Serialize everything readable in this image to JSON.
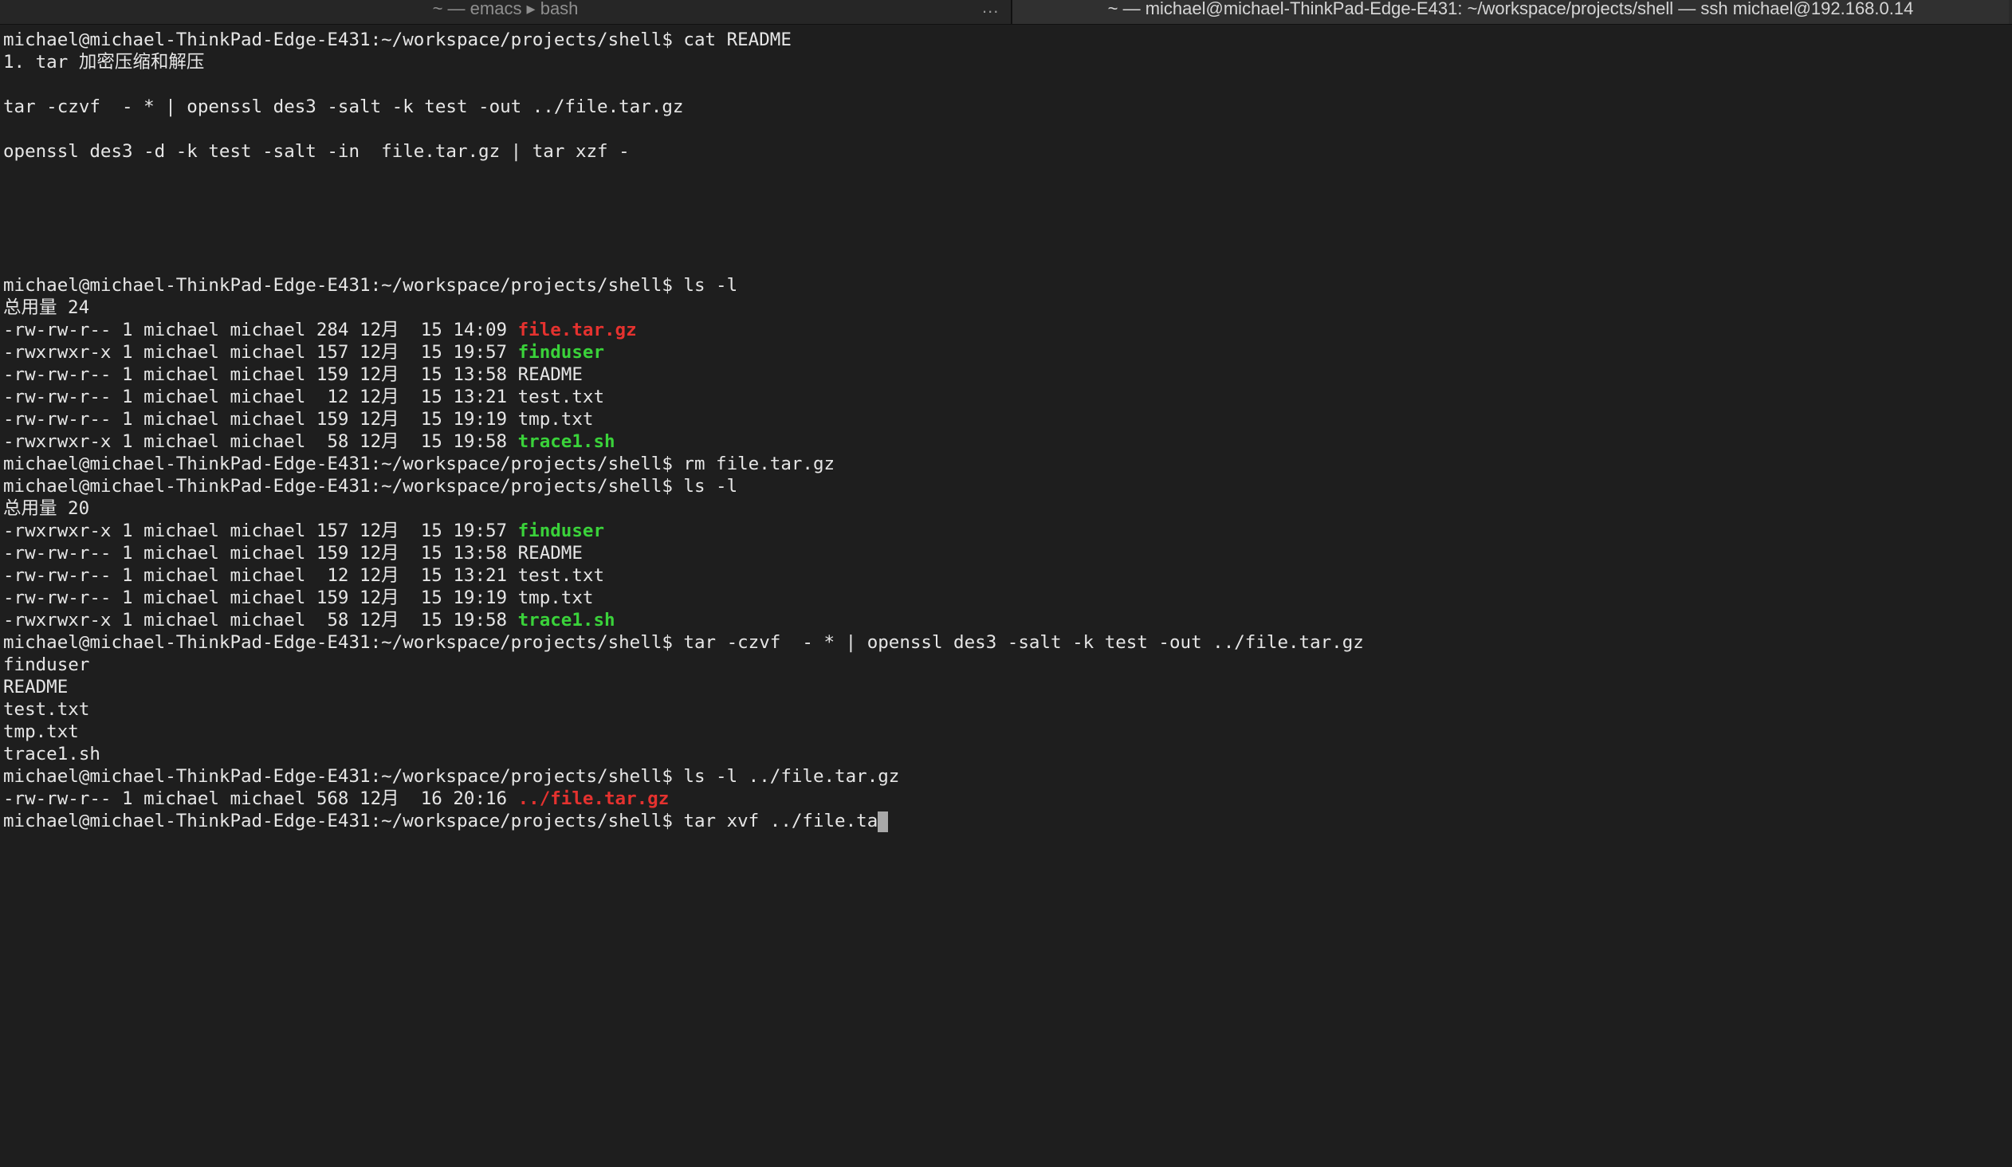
{
  "tabs": {
    "left_label": "~ — emacs ▸ bash",
    "more_label": "...",
    "right_label": "~ — michael@michael-ThinkPad-Edge-E431: ~/workspace/projects/shell — ssh michael@192.168.0.14"
  },
  "terminal": {
    "lines": [
      [
        {
          "t": "michael@michael-ThinkPad-Edge-E431:~/workspace/projects/shell$ cat README"
        }
      ],
      [
        {
          "t": "1. tar 加密压缩和解压"
        }
      ],
      [
        {
          "t": ""
        }
      ],
      [
        {
          "t": "tar -czvf  - * | openssl des3 -salt -k test -out ../file.tar.gz"
        }
      ],
      [
        {
          "t": ""
        }
      ],
      [
        {
          "t": "openssl des3 -d -k test -salt -in  file.tar.gz | tar xzf -"
        }
      ],
      [
        {
          "t": ""
        }
      ],
      [
        {
          "t": ""
        }
      ],
      [
        {
          "t": ""
        }
      ],
      [
        {
          "t": ""
        }
      ],
      [
        {
          "t": ""
        }
      ],
      [
        {
          "t": "michael@michael-ThinkPad-Edge-E431:~/workspace/projects/shell$ ls -l"
        }
      ],
      [
        {
          "t": "总用量 24"
        }
      ],
      [
        {
          "t": "-rw-rw-r-- 1 michael michael 284 12月  15 14:09 "
        },
        {
          "t": "file.tar.gz",
          "c": "red"
        }
      ],
      [
        {
          "t": "-rwxrwxr-x 1 michael michael 157 12月  15 19:57 "
        },
        {
          "t": "finduser",
          "c": "green"
        }
      ],
      [
        {
          "t": "-rw-rw-r-- 1 michael michael 159 12月  15 13:58 README"
        }
      ],
      [
        {
          "t": "-rw-rw-r-- 1 michael michael  12 12月  15 13:21 test.txt"
        }
      ],
      [
        {
          "t": "-rw-rw-r-- 1 michael michael 159 12月  15 19:19 tmp.txt"
        }
      ],
      [
        {
          "t": "-rwxrwxr-x 1 michael michael  58 12月  15 19:58 "
        },
        {
          "t": "trace1.sh",
          "c": "green"
        }
      ],
      [
        {
          "t": "michael@michael-ThinkPad-Edge-E431:~/workspace/projects/shell$ rm file.tar.gz"
        }
      ],
      [
        {
          "t": "michael@michael-ThinkPad-Edge-E431:~/workspace/projects/shell$ ls -l"
        }
      ],
      [
        {
          "t": "总用量 20"
        }
      ],
      [
        {
          "t": "-rwxrwxr-x 1 michael michael 157 12月  15 19:57 "
        },
        {
          "t": "finduser",
          "c": "green"
        }
      ],
      [
        {
          "t": "-rw-rw-r-- 1 michael michael 159 12月  15 13:58 README"
        }
      ],
      [
        {
          "t": "-rw-rw-r-- 1 michael michael  12 12月  15 13:21 test.txt"
        }
      ],
      [
        {
          "t": "-rw-rw-r-- 1 michael michael 159 12月  15 19:19 tmp.txt"
        }
      ],
      [
        {
          "t": "-rwxrwxr-x 1 michael michael  58 12月  15 19:58 "
        },
        {
          "t": "trace1.sh",
          "c": "green"
        }
      ],
      [
        {
          "t": "michael@michael-ThinkPad-Edge-E431:~/workspace/projects/shell$ tar -czvf  - * | openssl des3 -salt -k test -out ../file.tar.gz"
        }
      ],
      [
        {
          "t": "finduser"
        }
      ],
      [
        {
          "t": "README"
        }
      ],
      [
        {
          "t": "test.txt"
        }
      ],
      [
        {
          "t": "tmp.txt"
        }
      ],
      [
        {
          "t": "trace1.sh"
        }
      ],
      [
        {
          "t": "michael@michael-ThinkPad-Edge-E431:~/workspace/projects/shell$ ls -l ../file.tar.gz"
        }
      ],
      [
        {
          "t": "-rw-rw-r-- 1 michael michael 568 12月  16 20:16 "
        },
        {
          "t": "../file.tar.gz",
          "c": "red"
        }
      ],
      [
        {
          "t": "michael@michael-ThinkPad-Edge-E431:~/workspace/projects/shell$ tar xvf ../file.ta",
          "cursor": true
        }
      ]
    ]
  },
  "colors": {
    "background": "#1e1e1e",
    "foreground": "#e6e6e6",
    "red": "#e5322f",
    "green": "#3ad23a",
    "cursor": "#a8a8a8"
  }
}
